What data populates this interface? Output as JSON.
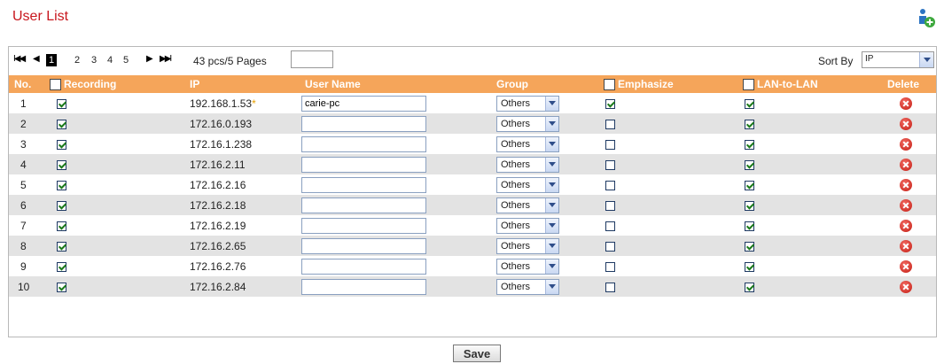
{
  "header": {
    "title": "User List",
    "add_icon": "add-user-icon"
  },
  "pager": {
    "first_glyph": "I◀◀",
    "prev_glyph": "◀",
    "pages": [
      "1",
      "2",
      "3",
      "4",
      "5"
    ],
    "active_page": "1",
    "next_glyph": "▶",
    "last_glyph": "▶▶I",
    "count_text": "43 pcs/5 Pages",
    "goto_value": ""
  },
  "sort": {
    "label": "Sort By",
    "value": "IP"
  },
  "columns": {
    "no": "No.",
    "recording": "Recording",
    "ip": "IP",
    "user_name": "User Name",
    "group": "Group",
    "emphasize": "Emphasize",
    "lan_to_lan": "LAN-to-LAN",
    "delete": "Delete"
  },
  "rows": [
    {
      "no": "1",
      "recording": true,
      "ip": "192.168.1.53",
      "star": "*",
      "user_name": "carie-pc",
      "group": "Others",
      "emphasize": true,
      "lan": true
    },
    {
      "no": "2",
      "recording": true,
      "ip": "172.16.0.193",
      "star": "",
      "user_name": "",
      "group": "Others",
      "emphasize": false,
      "lan": true
    },
    {
      "no": "3",
      "recording": true,
      "ip": "172.16.1.238",
      "star": "",
      "user_name": "",
      "group": "Others",
      "emphasize": false,
      "lan": true
    },
    {
      "no": "4",
      "recording": true,
      "ip": "172.16.2.11",
      "star": "",
      "user_name": "",
      "group": "Others",
      "emphasize": false,
      "lan": true
    },
    {
      "no": "5",
      "recording": true,
      "ip": "172.16.2.16",
      "star": "",
      "user_name": "",
      "group": "Others",
      "emphasize": false,
      "lan": true
    },
    {
      "no": "6",
      "recording": true,
      "ip": "172.16.2.18",
      "star": "",
      "user_name": "",
      "group": "Others",
      "emphasize": false,
      "lan": true
    },
    {
      "no": "7",
      "recording": true,
      "ip": "172.16.2.19",
      "star": "",
      "user_name": "",
      "group": "Others",
      "emphasize": false,
      "lan": true
    },
    {
      "no": "8",
      "recording": true,
      "ip": "172.16.2.65",
      "star": "",
      "user_name": "",
      "group": "Others",
      "emphasize": false,
      "lan": true
    },
    {
      "no": "9",
      "recording": true,
      "ip": "172.16.2.76",
      "star": "",
      "user_name": "",
      "group": "Others",
      "emphasize": false,
      "lan": true
    },
    {
      "no": "10",
      "recording": true,
      "ip": "172.16.2.84",
      "star": "",
      "user_name": "",
      "group": "Others",
      "emphasize": false,
      "lan": true
    }
  ],
  "footer": {
    "save_label": "Save"
  },
  "colors": {
    "title": "#c8161d",
    "header_bg": "#f5a55a",
    "alt_row": "#e3e3e3",
    "delete": "#d6281e",
    "star": "#e8a000"
  }
}
